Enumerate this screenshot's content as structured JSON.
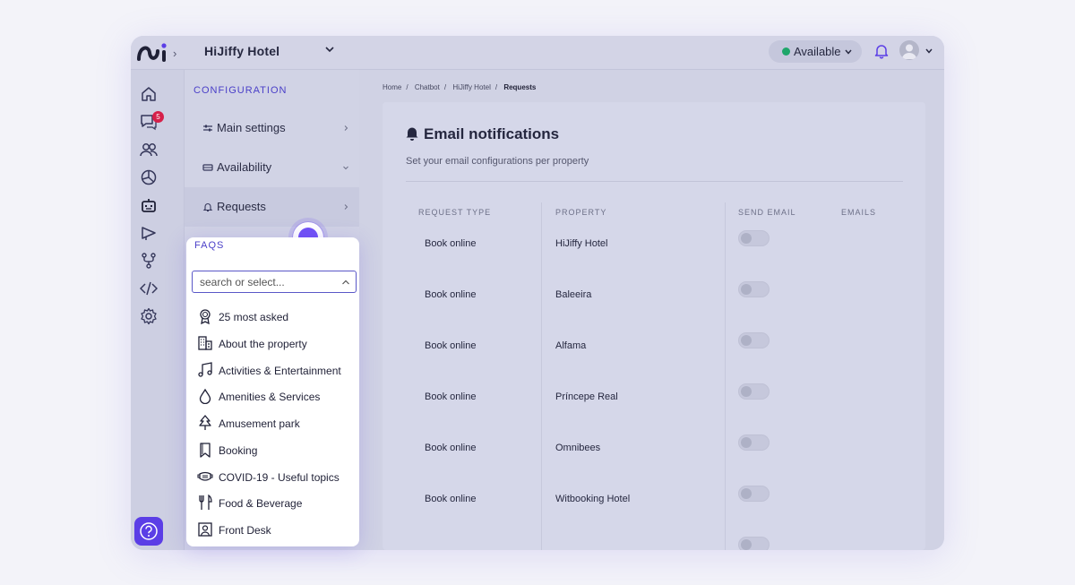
{
  "topbar": {
    "hotel_name": "HiJiffy Hotel",
    "availability": "Available"
  },
  "rail": {
    "badge_count": "5"
  },
  "config": {
    "title": "CONFIGURATION",
    "items": [
      {
        "label": "Main settings"
      },
      {
        "label": "Availability"
      },
      {
        "label": "Requests"
      }
    ]
  },
  "breadcrumb": [
    "Home",
    "/",
    "Chatbot",
    "/",
    "HiJiffy Hotel",
    "/",
    "Requests"
  ],
  "card": {
    "title": "Email notifications",
    "subtitle": "Set your email configurations per property",
    "headers": [
      "REQUEST TYPE",
      "PROPERTY",
      "SEND EMAIL",
      "EMAILS"
    ],
    "rows": [
      {
        "type": "Book online",
        "property": "HiJiffy Hotel"
      },
      {
        "type": "Book online",
        "property": "Baleeira"
      },
      {
        "type": "Book online",
        "property": "Alfama"
      },
      {
        "type": "Book online",
        "property": "Príncepe Real"
      },
      {
        "type": "Book online",
        "property": "Omnibees"
      },
      {
        "type": "Book online",
        "property": "Witbooking Hotel"
      }
    ]
  },
  "faq_dropdown": {
    "title": "FAQS",
    "placeholder": "search or select...",
    "options": [
      {
        "label": "25 most asked",
        "icon": "ribbon-icon"
      },
      {
        "label": "About the property",
        "icon": "building-icon"
      },
      {
        "label": "Activities & Entertainment",
        "icon": "music-icon"
      },
      {
        "label": "Amenities & Services",
        "icon": "drop-icon"
      },
      {
        "label": "Amusement park",
        "icon": "tree-icon"
      },
      {
        "label": "Booking",
        "icon": "bookmark-icon"
      },
      {
        "label": "COVID-19 - Useful topics",
        "icon": "mask-icon"
      },
      {
        "label": "Food & Beverage",
        "icon": "utensils-icon"
      },
      {
        "label": "Front Desk",
        "icon": "portrait-icon"
      }
    ]
  },
  "colors": {
    "accent": "#5b3ee6",
    "available": "#1fa66a",
    "badge": "#d6204a"
  }
}
